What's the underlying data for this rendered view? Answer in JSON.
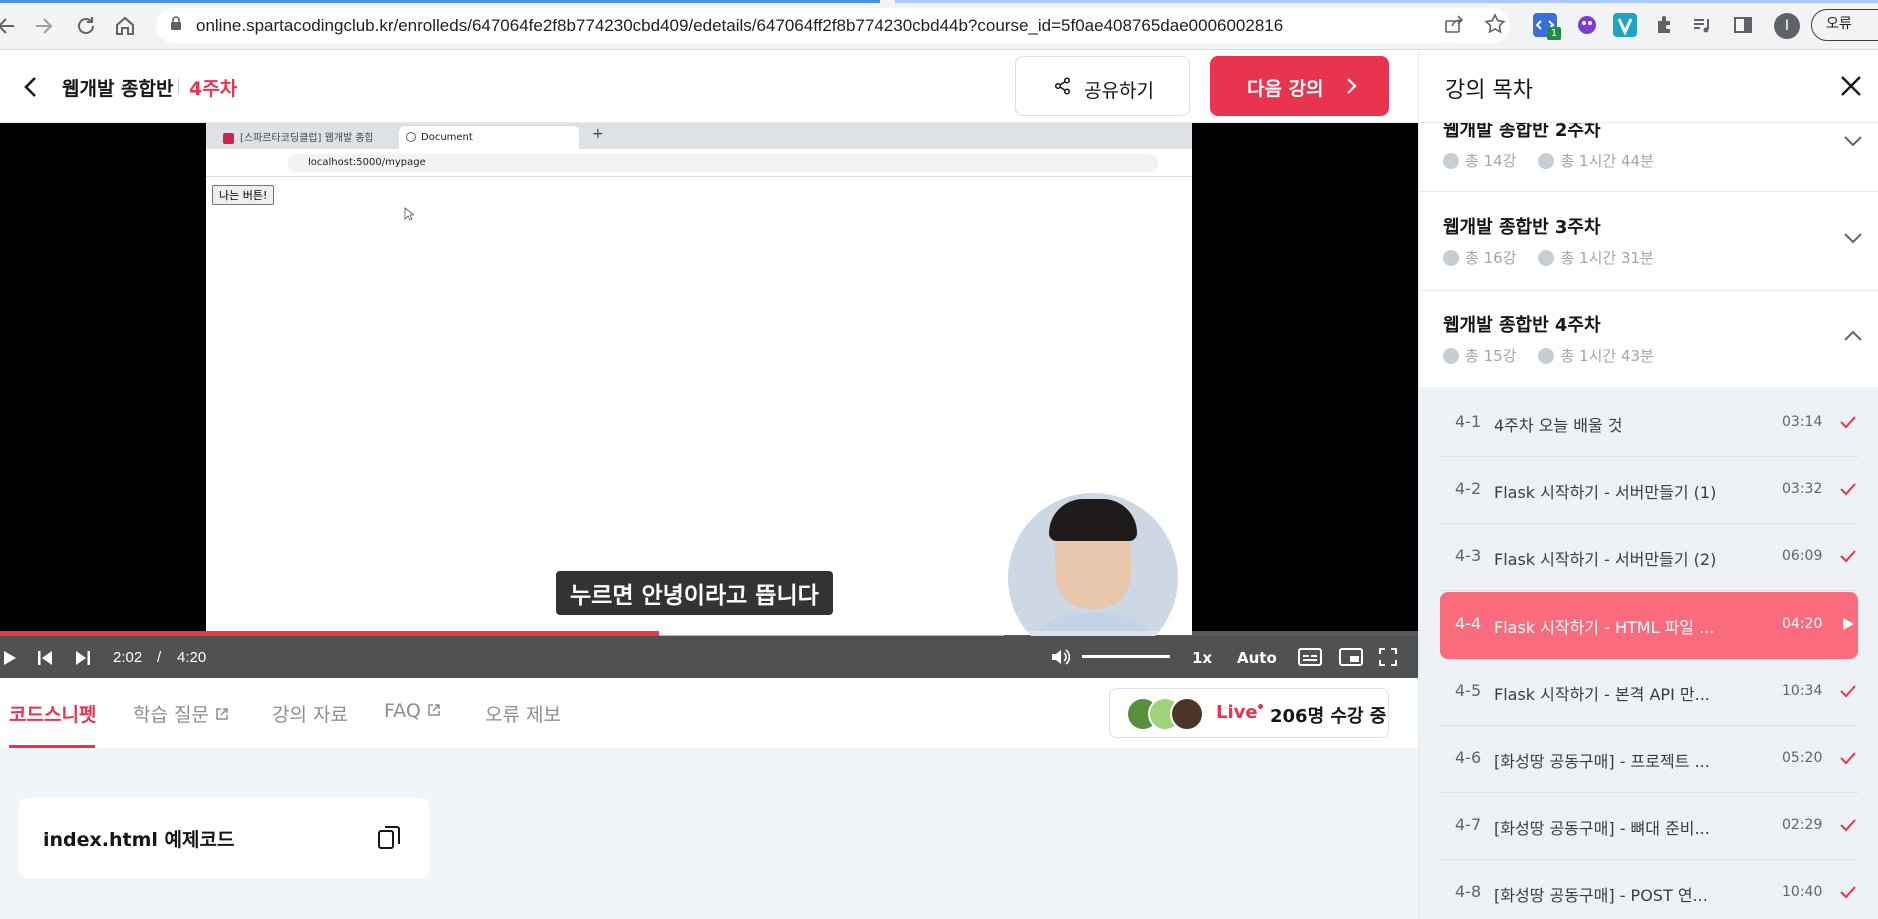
{
  "browser": {
    "url": "online.spartacodingclub.kr/enrolleds/647064fe2f8b774230cbd409/edetails/647064ff2f8b774230cbd44b?course_id=5f0ae408765dae0006002816",
    "profile_initial": "I",
    "error_label": "오류",
    "ext_badge": "1"
  },
  "header": {
    "course_title": "웹개발 종합반",
    "week": "4주차",
    "share_label": "공유하기",
    "next_label": "다음 강의"
  },
  "video": {
    "inner_tab1": "[스파르타코딩클럽] 웹개발 종합",
    "inner_tab2": "Document",
    "inner_url": "localhost:5000/mypage",
    "inner_button": "나는 버튼!",
    "subtitle": "누르면 안녕이라고 뜹니다",
    "current_time": "2:02",
    "time_sep": "/",
    "duration": "4:20",
    "progress": 0.465,
    "buffered": 0.708,
    "speed": "1x",
    "quality": "Auto"
  },
  "tabs": [
    {
      "label": "코드스니펫",
      "active": true
    },
    {
      "label": "학습 질문",
      "external": true
    },
    {
      "label": "강의 자료"
    },
    {
      "label": "FAQ",
      "external": true
    },
    {
      "label": "오류 제보"
    }
  ],
  "live": {
    "label": "Live",
    "count": "206명 수강 중"
  },
  "snippet": {
    "title": "index.html 예제코드"
  },
  "sidebar": {
    "title": "강의 목차",
    "weeks": [
      {
        "name": "웹개발 종합반 2주차",
        "lessons": "총 14강",
        "time": "총 1시간 44분",
        "expanded": false
      },
      {
        "name": "웹개발 종합반 3주차",
        "lessons": "총 16강",
        "time": "총 1시간 31분",
        "expanded": false
      },
      {
        "name": "웹개발 종합반 4주차",
        "lessons": "총 15강",
        "time": "총 1시간 43분",
        "expanded": true
      }
    ],
    "lessons": [
      {
        "num": "4-1",
        "name": "4주차 오늘 배울 것",
        "dur": "03:14",
        "done": true
      },
      {
        "num": "4-2",
        "name": "Flask 시작하기 - 서버만들기 (1)",
        "dur": "03:32",
        "done": true
      },
      {
        "num": "4-3",
        "name": "Flask 시작하기 - 서버만들기 (2)",
        "dur": "06:09",
        "done": true
      },
      {
        "num": "4-4",
        "name": "Flask 시작하기 - HTML 파일 ...",
        "dur": "04:20",
        "playing": true
      },
      {
        "num": "4-5",
        "name": "Flask 시작하기 - 본격 API 만...",
        "dur": "10:34",
        "done": true
      },
      {
        "num": "4-6",
        "name": "[화성땅 공동구매] - 프로젝트 ...",
        "dur": "05:20",
        "done": true
      },
      {
        "num": "4-7",
        "name": "[화성땅 공동구매] - 뼈대 준비...",
        "dur": "02:29",
        "done": true
      },
      {
        "num": "4-8",
        "name": "[화성땅 공동구매] - POST 연...",
        "dur": "10:40",
        "done": true
      }
    ]
  },
  "colors": {
    "accent": "#e8344e",
    "active_lesson": "#fa6b7d",
    "check": "#e8344e"
  }
}
